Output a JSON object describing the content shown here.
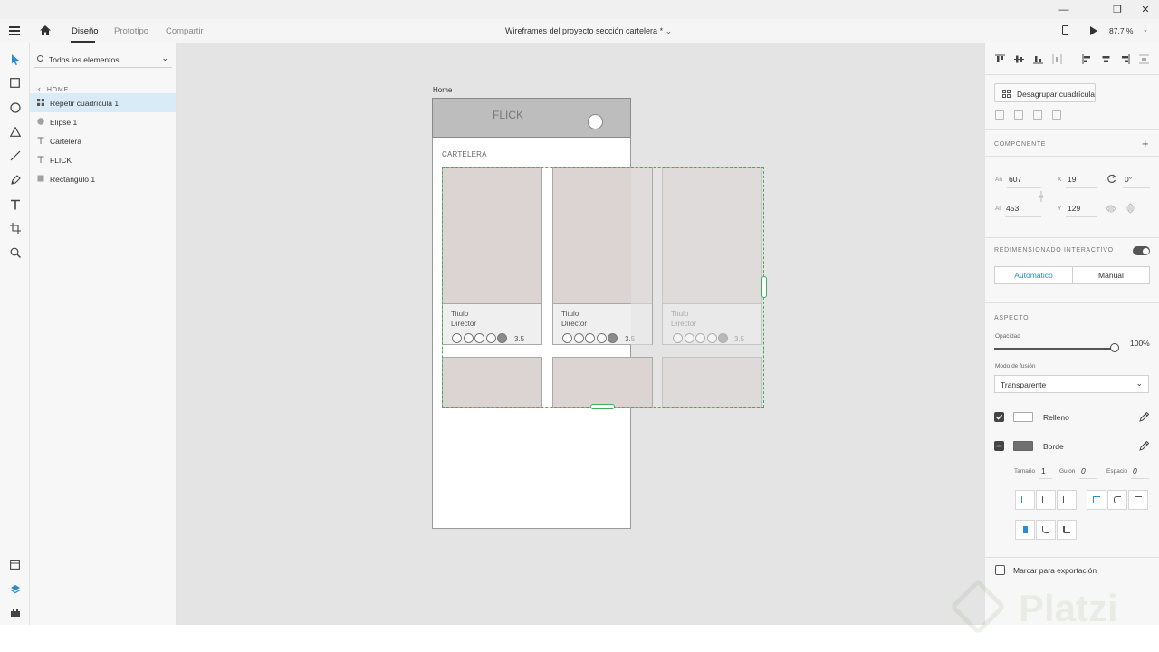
{
  "window": {
    "minimize": "—",
    "restore": "❐",
    "close": "✕"
  },
  "appbar": {
    "tabs": [
      "Diseño",
      "Prototipo",
      "Compartir"
    ],
    "doc_title": "Wireframes del proyecto sección cartelera *",
    "zoom": "87.7 %",
    "caret": "⌄"
  },
  "toolbar": {
    "tools": [
      "select-icon",
      "rectangle-icon",
      "ellipse-icon",
      "triangle-icon",
      "line-icon",
      "pen-icon",
      "text-icon",
      "artboard-icon",
      "zoom-icon"
    ],
    "bottom": [
      "assets-icon",
      "layers-icon",
      "plugins-icon"
    ]
  },
  "layers": {
    "filter_label": "Todos los elementos",
    "crumb": "HOME",
    "items": [
      {
        "label": "Repetir cuadrícula 1",
        "icon": "repeat-grid-icon",
        "selected": true
      },
      {
        "label": "Elipse 1",
        "icon": "ellipse-icon",
        "selected": false
      },
      {
        "label": "Cartelera",
        "icon": "text-icon",
        "selected": false
      },
      {
        "label": "FLICK",
        "icon": "text-icon",
        "selected": false
      },
      {
        "label": "Rectángulo 1",
        "icon": "rectangle-icon",
        "selected": false
      }
    ]
  },
  "canvas": {
    "artboard_name": "Home",
    "app_name": "FLICK",
    "section_title": "CARTELERA",
    "cards": [
      {
        "title": "Titulo",
        "director": "Director",
        "rating": "3.5"
      },
      {
        "title": "Titulo",
        "director": "Director",
        "rating": "3.5"
      },
      {
        "title": "Titulo",
        "director": "Director",
        "rating": "3.5"
      }
    ]
  },
  "props": {
    "ungroup_label": "Desagrupar cuadrícula",
    "component_title": "COMPONENTE",
    "plus": "+",
    "fields": {
      "an_label": "An",
      "an_value": "607",
      "x_label": "X",
      "x_value": "19",
      "rot_value": "0°",
      "al_label": "Al",
      "al_value": "453",
      "y_label": "Y",
      "y_value": "129"
    },
    "responsive_title": "REDIMENSIONADO INTERACTIVO",
    "responsive_on": true,
    "seg_auto": "Automático",
    "seg_manual": "Manual",
    "appearance_title": "ASPECTO",
    "opacity_label": "Opacidad",
    "opacity_value": "100%",
    "blend_label": "Modo de fusión",
    "blend_value": "Transparente",
    "fill_label": "Relleno",
    "border_label": "Borde",
    "size_label": "Tamaño",
    "size_value": "1",
    "dash_label": "Guion",
    "dash_value": "0",
    "gap_label": "Espacio",
    "gap_value": "0",
    "export_label": "Marcar para exportación",
    "accent": "#2a8bd2"
  },
  "watermark": "Platzi"
}
